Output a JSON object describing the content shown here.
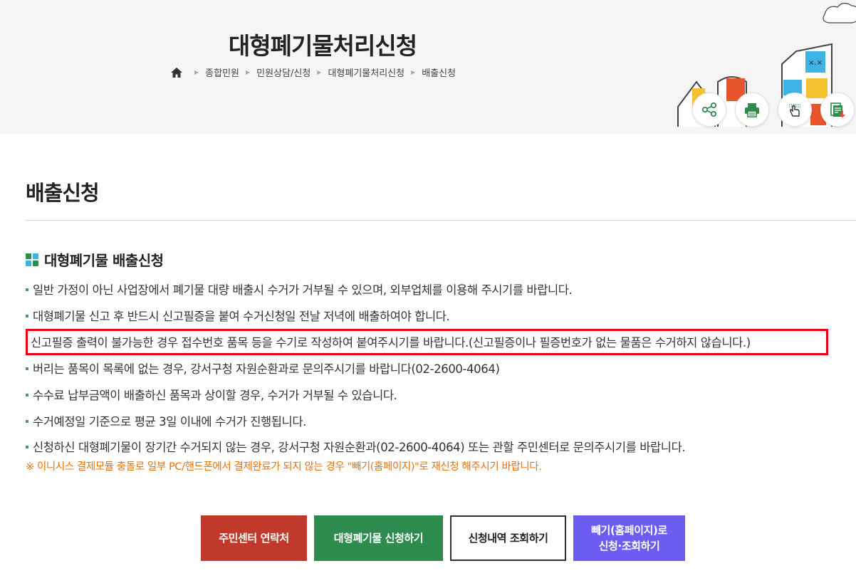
{
  "header": {
    "title": "대형폐기물처리신청",
    "breadcrumb": [
      "종합민원",
      "민원상담/신청",
      "대형폐기물처리신청",
      "배출신청"
    ],
    "tools": [
      {
        "name": "share",
        "icon": "share-icon"
      },
      {
        "name": "print",
        "icon": "print-icon"
      },
      {
        "name": "touch",
        "icon": "hand-pointer-icon"
      },
      {
        "name": "download",
        "icon": "download-icon"
      }
    ]
  },
  "main": {
    "section_title": "배출신청",
    "sub_heading": "대형폐기물 배출신청",
    "notices": [
      "일반 가정이 아닌 사업장에서 폐기물 대량 배출시 수거가 거부될 수 있으며, 외부업체를 이용해 주시기를 바랍니다.",
      "대형폐기물 신고 후 반드시 신고필증을 붙여 수거신청일 전날 저녁에 배출하여야 합니다.",
      "신고필증 출력이 불가능한 경우 접수번호 품목 등을 수기로 작성하여 붙여주시기를 바랍니다.(신고필증이나 필증번호가 없는 물품은 수거하지 않습니다.)",
      "버리는 품목이 목록에 없는 경우, 강서구청 자원순환과로 문의주시기를 바랍니다(02-2600-4064)",
      "수수료 납부금액이 배출하신 품목과 상이할 경우, 수거가 거부될 수 있습니다.",
      "수거예정일 기준으로 평균 3일 이내에 수거가 진행됩니다.",
      "신청하신 대형폐기물이 장기간 수거되지 않는 경우, 강서구청 자원순환과(02-2600-4064) 또는 관할 주민센터로 문의주시기를 바랍니다."
    ],
    "warning": "※ 이니시스 결제모듈 충돌로 일부 PC/핸드폰에서 결제완료가 되지 않는 경우 \"빼기(홈페이지)\"로 재신청 해주시기 바랍니다.",
    "buttons": {
      "community_center": "주민센터 연락처",
      "apply": "대형폐기물 신청하기",
      "history": "신청내역 조회하기",
      "ppaegi_line1": "빼기(홈페이지)로",
      "ppaegi_line2": "신청·조회하기"
    }
  },
  "colors": {
    "highlight_border": "#e60012",
    "warning_text": "#e8730c",
    "btn_red": "#c0392b",
    "btn_green": "#2e8b4e",
    "btn_purple": "#6c5cf2"
  }
}
